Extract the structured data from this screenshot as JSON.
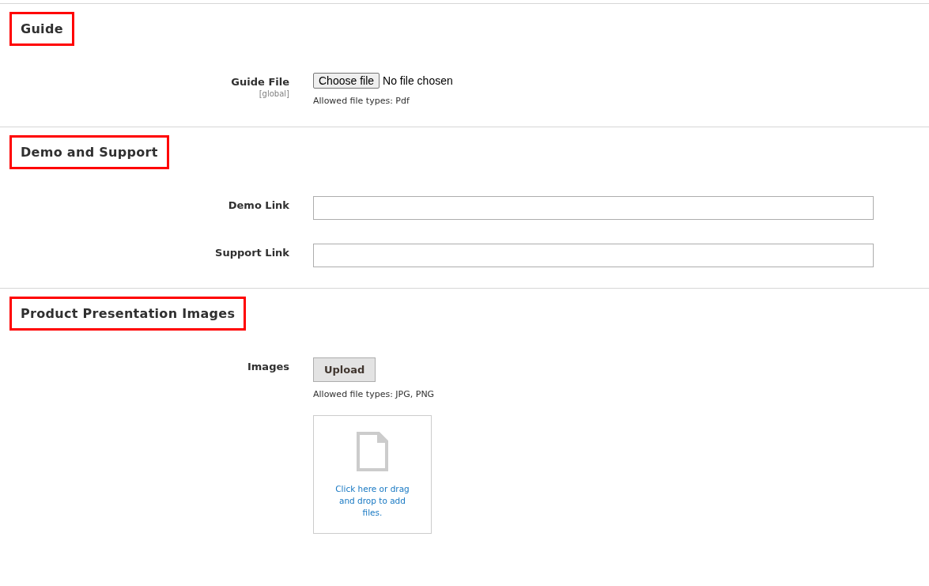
{
  "sections": [
    {
      "title": "Guide",
      "highlighted": true,
      "fields": [
        {
          "kind": "file",
          "label": "Guide File",
          "scope": "[global]",
          "button": "Choose file",
          "status": "No file chosen",
          "note": "Allowed file types: Pdf"
        }
      ]
    },
    {
      "title": "Demo and Support",
      "highlighted": true,
      "fields": [
        {
          "kind": "text",
          "label": "Demo Link"
        },
        {
          "kind": "text",
          "label": "Support Link"
        }
      ]
    },
    {
      "title": "Product Presentation Images",
      "highlighted": true,
      "fields": [
        {
          "kind": "upload",
          "label": "Images",
          "button": "Upload",
          "note": "Allowed file types: JPG, PNG",
          "drop_text": "Click here or drag and drop to add files."
        }
      ]
    }
  ]
}
